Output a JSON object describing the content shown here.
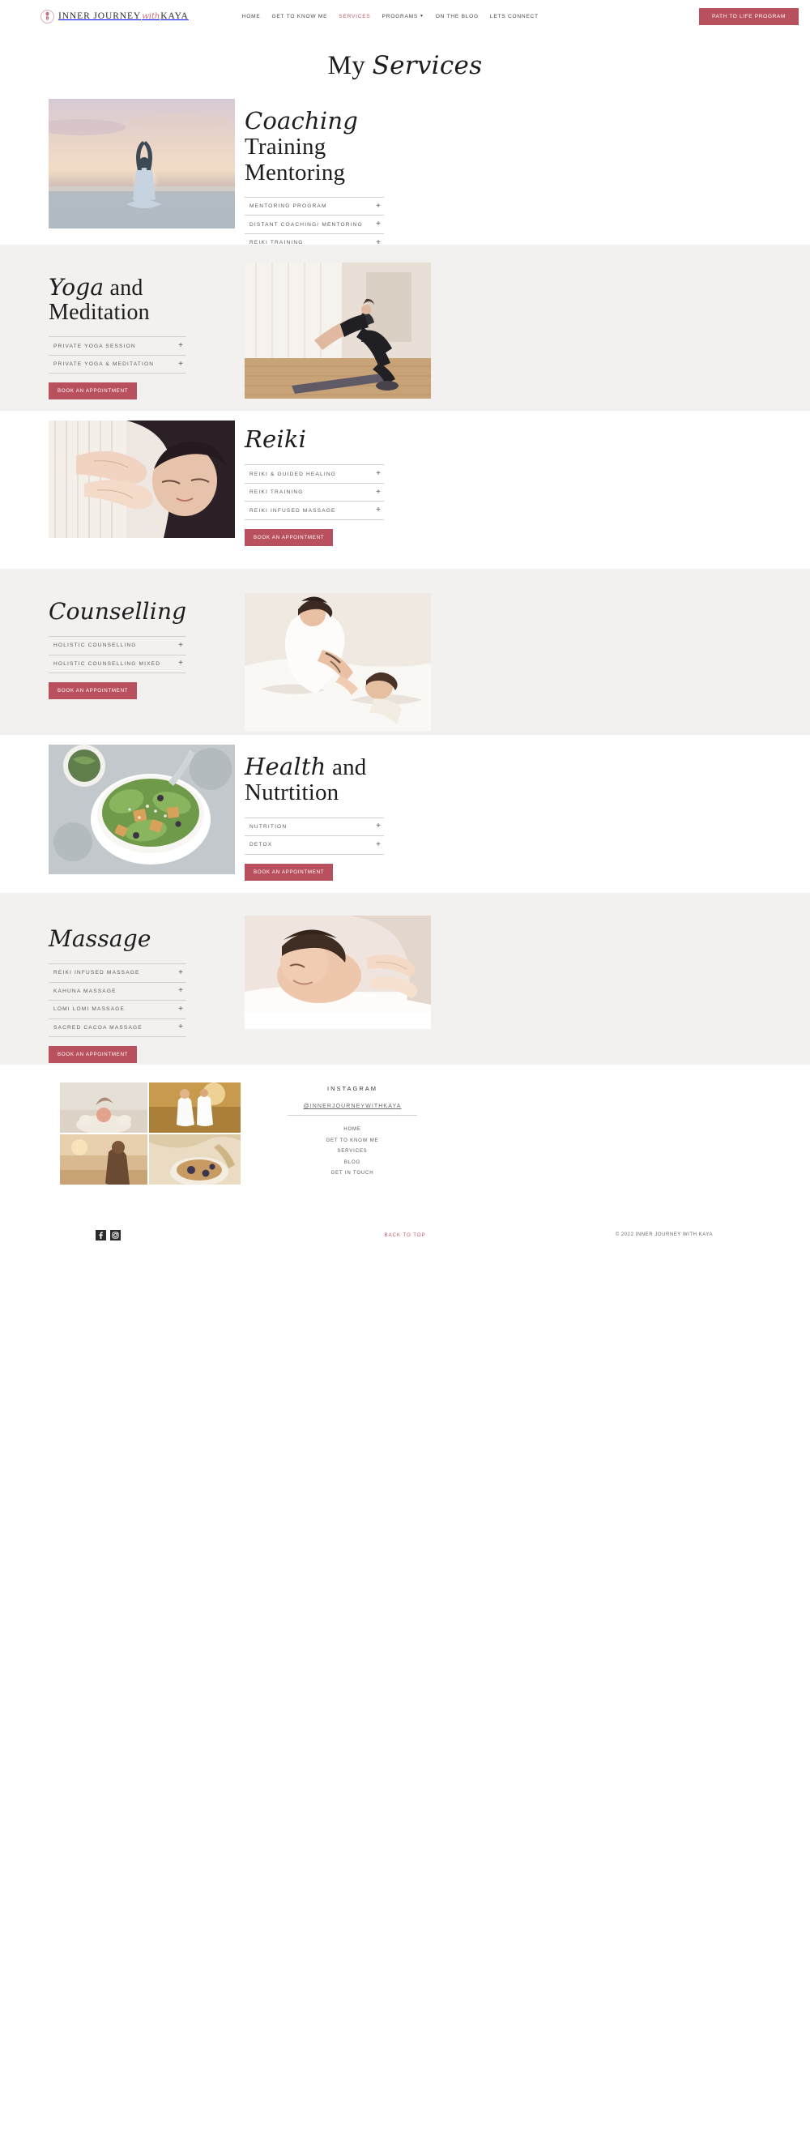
{
  "header": {
    "brand_pre": "INNER JOURNEY",
    "brand_script": "with",
    "brand_post": "KAYA",
    "nav": [
      {
        "label": "HOME",
        "active": false,
        "caret": false
      },
      {
        "label": "GET TO KNOW ME",
        "active": false,
        "caret": false
      },
      {
        "label": "SERVICES",
        "active": true,
        "caret": false
      },
      {
        "label": "PROGRAMS",
        "active": false,
        "caret": true
      },
      {
        "label": "ON THE BLOG",
        "active": false,
        "caret": false
      },
      {
        "label": "LETS CONNECT",
        "active": false,
        "caret": false
      }
    ],
    "cta_label": "PATH TO LIFE PROGRAM"
  },
  "page": {
    "title_plain": "My ",
    "title_italic": "Services"
  },
  "book_label": "BOOK AN APPOINTMENT",
  "sections": [
    {
      "id": "coaching",
      "heading_italic": "Coaching",
      "heading_plain": " Training Mentoring",
      "items": [
        "MENTORING PROGRAM",
        "DISTANT COACHING/ MENTORING",
        "REIKI TRAINING"
      ]
    },
    {
      "id": "yoga",
      "heading_italic": "Yoga",
      "heading_plain": " and Meditation",
      "items": [
        "PRIVATE YOGA SESSION",
        "PRIVATE YOGA & MEDITATION"
      ]
    },
    {
      "id": "reiki",
      "heading_italic": "Reiki",
      "heading_plain": "",
      "items": [
        "REIKI & GUIDED HEALING",
        "REIKI TRAINING",
        "REIKI INFUSED MASSAGE"
      ]
    },
    {
      "id": "counselling",
      "heading_italic": "Counselling",
      "heading_plain": "",
      "items": [
        "HOLISTIC COUNSELLING",
        "HOLISTIC COUNSELLING MIXED"
      ]
    },
    {
      "id": "health",
      "heading_italic": "Health",
      "heading_plain": " and Nutrtition",
      "items": [
        "NUTRITION",
        "DETOX"
      ]
    },
    {
      "id": "massage",
      "heading_italic": "Massage",
      "heading_plain": "",
      "items": [
        "REIKI INFUSED MASSAGE",
        "KAHUNA MASSAGE",
        "LOMI LOMI MASSAGE",
        "SACRED CACOA MASSAGE"
      ]
    }
  ],
  "footer": {
    "instagram_title": "INSTAGRAM",
    "handle": "@INNERJOURNEYWITHKAYA",
    "links": [
      "HOME",
      "GET TO KNOW ME",
      "SERVICES",
      "BLOG",
      "GET IN TOUCH"
    ],
    "back_to_top": "BACK TO TOP",
    "copyright": "© 2022 INNER JOURNEY WITH KAYA",
    "social": [
      "facebook-icon",
      "instagram-icon"
    ]
  },
  "colors": {
    "accent": "#b9505e",
    "accent_text": "#c05b68",
    "tinted_bg": "#f3f1ef",
    "rule": "#cfcfcf"
  }
}
